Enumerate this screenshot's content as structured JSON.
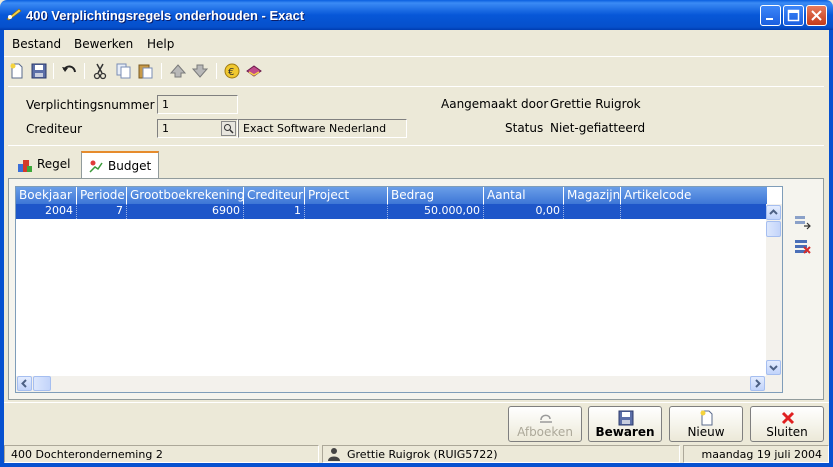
{
  "window": {
    "title": "400 Verplichtingsregels onderhouden - Exact"
  },
  "menu": {
    "items": [
      "Bestand",
      "Bewerken",
      "Help"
    ]
  },
  "toolbar": {
    "icons": [
      "new-icon",
      "save-icon",
      "undo-icon",
      "cut-icon",
      "copy-icon",
      "paste-icon",
      "move-up-icon",
      "move-down-icon",
      "euro-icon",
      "book-icon"
    ]
  },
  "header": {
    "verplichtingsnummer_label": "Verplichtingsnummer",
    "verplichtingsnummer_value": "1",
    "crediteur_label": "Crediteur",
    "crediteur_value": "1",
    "crediteur_name": "Exact Software Nederland",
    "aangemaakt_label": "Aangemaakt door",
    "aangemaakt_value": "Grettie Ruigrok",
    "status_label": "Status",
    "status_value": "Niet-gefiatteerd"
  },
  "tabs": [
    {
      "label": "Regel",
      "active": false
    },
    {
      "label": "Budget",
      "active": true
    }
  ],
  "grid": {
    "columns": [
      "Boekjaar",
      "Periode",
      "Grootboekrekening",
      "Crediteur",
      "Project",
      "Bedrag",
      "Aantal",
      "Magazijn",
      "Artikelcode"
    ],
    "rows": [
      [
        "2004",
        "7",
        "6900",
        "1",
        "",
        "50.000,00",
        "0,00",
        "",
        ""
      ]
    ]
  },
  "buttons": {
    "afboeken": "Afboeken",
    "bewaren": "Bewaren",
    "nieuw": "Nieuw",
    "sluiten": "Sluiten"
  },
  "status": {
    "company": "400 Dochteronderneming 2",
    "user": "Grettie Ruigrok (RUIG5722)",
    "date": "maandag 19 juli 2004"
  },
  "colors": {
    "titlebar": "#0757D8",
    "selection": "#1E56C9",
    "header": "#3D76D6",
    "tab_accent": "#E68B2C"
  }
}
